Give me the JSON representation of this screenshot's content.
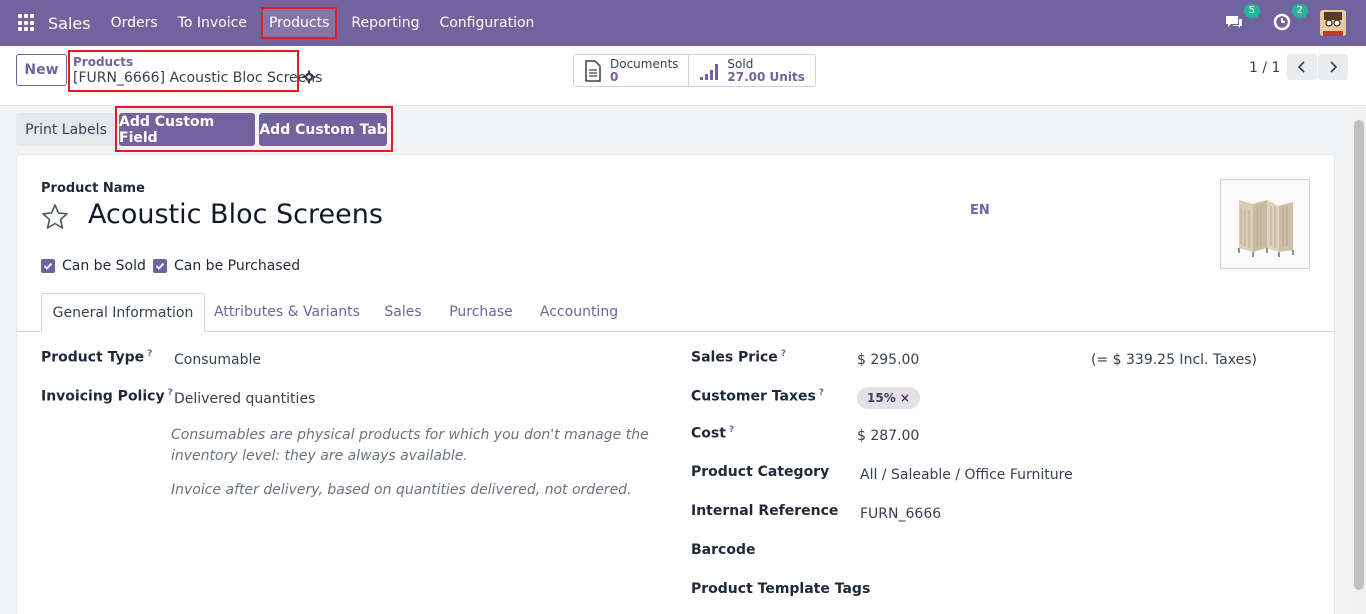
{
  "nav": {
    "brand": "Sales",
    "items": [
      {
        "label": "Orders"
      },
      {
        "label": "To Invoice"
      },
      {
        "label": "Products"
      },
      {
        "label": "Reporting"
      },
      {
        "label": "Configuration"
      }
    ],
    "messages_count": "5",
    "activities_count": "2",
    "accent_color": "#71639e",
    "badge_color": "#21b799"
  },
  "control": {
    "new_label": "New",
    "breadcrumb_parent": "Products",
    "breadcrumb_current": "[FURN_6666] Acoustic Bloc Screens",
    "stats": [
      {
        "label": "Documents",
        "value": "0",
        "icon": "document-icon"
      },
      {
        "label": "Sold",
        "value": "27.00 Units",
        "icon": "bar-chart-icon"
      }
    ],
    "pager": "1 / 1"
  },
  "actions": {
    "print_labels": "Print Labels",
    "add_custom_field": "Add Custom Field",
    "add_custom_tab": "Add Custom Tab"
  },
  "form": {
    "name_label": "Product Name",
    "name": "Acoustic Bloc Screens",
    "lang": "EN",
    "can_be_sold": "Can be Sold",
    "can_be_purchased": "Can be Purchased",
    "tabs": [
      {
        "label": "General Information"
      },
      {
        "label": "Attributes & Variants"
      },
      {
        "label": "Sales"
      },
      {
        "label": "Purchase"
      },
      {
        "label": "Accounting"
      }
    ],
    "left": {
      "product_type_label": "Product Type",
      "product_type": "Consumable",
      "invoicing_policy_label": "Invoicing Policy",
      "invoicing_policy": "Delivered quantities",
      "help_consumable": "Consumables are physical products for which you don't manage the inventory level: they are always available.",
      "help_invoice": "Invoice after delivery, based on quantities delivered, not ordered."
    },
    "right": {
      "sales_price_label": "Sales Price",
      "sales_price": "$ 295.00",
      "incl_taxes": "(= $ 339.25 Incl. Taxes)",
      "customer_taxes_label": "Customer Taxes",
      "customer_tax_tag": "15%",
      "cost_label": "Cost",
      "cost": "$ 287.00",
      "category_label": "Product Category",
      "category": "All / Saleable / Office Furniture",
      "internal_ref_label": "Internal Reference",
      "internal_ref": "FURN_6666",
      "barcode_label": "Barcode",
      "template_tags_label": "Product Template Tags"
    }
  }
}
